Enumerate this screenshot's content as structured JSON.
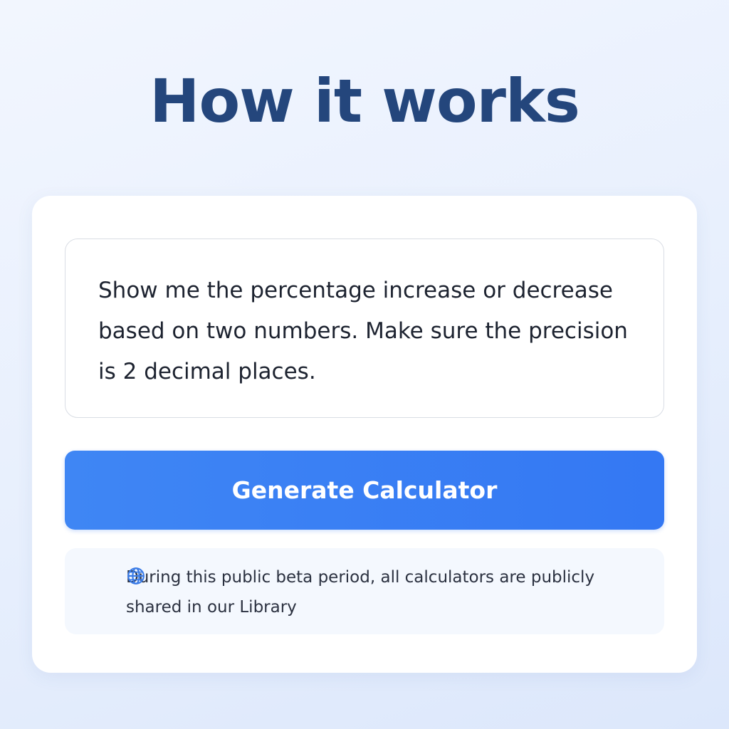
{
  "page": {
    "title": "How it works"
  },
  "prompt": {
    "text": "Show me the percentage increase or decrease based on two numbers. Make sure the precision is 2 decimal places."
  },
  "actions": {
    "generate_label": "Generate Calculator"
  },
  "notice": {
    "icon": "globe-icon",
    "text": "During this public beta period, all calculators are publicly shared in our Library"
  },
  "colors": {
    "title": "#24467c",
    "accent": "#3478f3",
    "notice_bg": "#f4f8fe"
  }
}
